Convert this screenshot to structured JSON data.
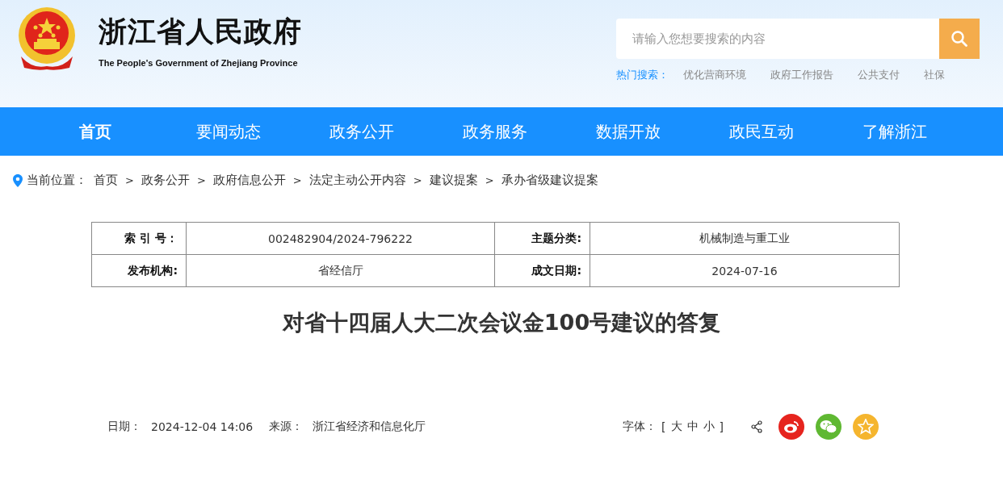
{
  "header": {
    "title": "浙江省人民政府",
    "subtitle": "The People's Government of Zhejiang Province",
    "search": {
      "placeholder": "请输入您想要搜索的内容"
    },
    "hot_label": "热门搜索：",
    "hot_searches": [
      "优化营商环境",
      "政府工作报告",
      "公共支付",
      "社保"
    ]
  },
  "nav": [
    {
      "label": "首页",
      "selected": true
    },
    {
      "label": "要闻动态",
      "selected": false
    },
    {
      "label": "政务公开",
      "selected": false
    },
    {
      "label": "政务服务",
      "selected": false
    },
    {
      "label": "数据开放",
      "selected": false
    },
    {
      "label": "政民互动",
      "selected": false
    },
    {
      "label": "了解浙江",
      "selected": false
    }
  ],
  "breadcrumb": {
    "label": "当前位置：",
    "separator": ">",
    "items": [
      "首页",
      "政务公开",
      "政府信息公开",
      "法定主动公开内容",
      "建议提案",
      "承办省级建议提案"
    ]
  },
  "info_table": {
    "rows": [
      [
        {
          "label": "索 引 号：",
          "value": "002482904/2024-796222"
        },
        {
          "label": "主题分类:",
          "value": "机械制造与重工业"
        }
      ],
      [
        {
          "label": "发布机构:",
          "value": "省经信厅"
        },
        {
          "label": "成文日期:",
          "value": "2024-07-16"
        }
      ]
    ]
  },
  "article": {
    "title": "对省十四届人大二次会议金100号建议的答复",
    "date_label": "日期：",
    "date": "2024-12-04 14:06",
    "source_label": "来源：",
    "source": "浙江省经济和信息化厅",
    "font_size": {
      "label": "字体：",
      "open": "[",
      "options": [
        "大",
        "中",
        "小"
      ],
      "close": "]"
    },
    "share": [
      {
        "kind": "weibo",
        "color": "#e6241e"
      },
      {
        "kind": "wechat",
        "color": "#5fb832"
      },
      {
        "kind": "favorite",
        "color": "#f5b52e"
      }
    ]
  }
}
